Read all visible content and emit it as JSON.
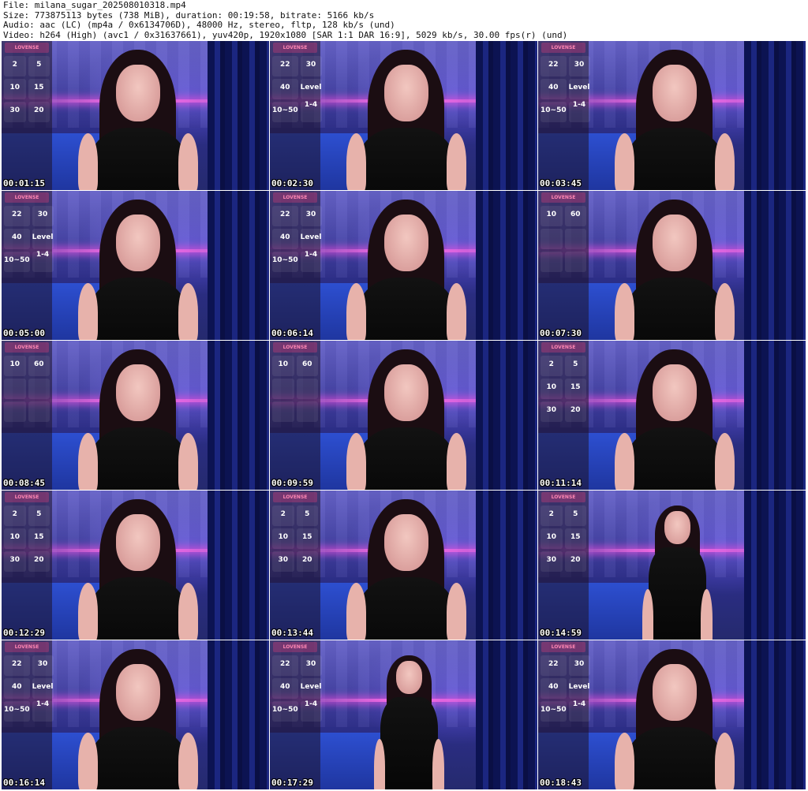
{
  "header": {
    "file": "File: milana_sugar_202508010318.mp4",
    "size": "Size: 773875113 bytes (738 MiB), duration: 00:19:58, bitrate: 5166 kb/s",
    "audio": "Audio: aac (LC) (mp4a / 0x6134706D), 48000 Hz, stereo, fltp, 128 kb/s (und)",
    "video": "Video: h264 (High) (avc1 / 0x31637661), yuv420p, 1920x1080 [SAR 1:1 DAR 16:9], 5029 kb/s, 30.00 fps(r) (und)"
  },
  "thumbnails": [
    {
      "time": "00:01:15"
    },
    {
      "time": "00:02:30"
    },
    {
      "time": "00:03:45"
    },
    {
      "time": "00:05:00"
    },
    {
      "time": "00:06:14"
    },
    {
      "time": "00:07:30"
    },
    {
      "time": "00:08:45"
    },
    {
      "time": "00:09:59"
    },
    {
      "time": "00:11:14"
    },
    {
      "time": "00:12:29"
    },
    {
      "time": "00:13:44"
    },
    {
      "time": "00:14:59"
    },
    {
      "time": "00:16:14"
    },
    {
      "time": "00:17:29"
    },
    {
      "time": "00:18:43"
    }
  ],
  "overlay_brand": "LOVENSE",
  "tile_sets": {
    "a": [
      "2",
      "5",
      "10",
      "15",
      "30",
      "20"
    ],
    "b": [
      "22",
      "30",
      "40",
      "Level 1-4",
      "10~50",
      ""
    ],
    "c": [
      "10",
      "60",
      "",
      "",
      "",
      ""
    ]
  },
  "colors": {
    "background": "#ffffff",
    "header_text": "#111111",
    "timestamp_text": "#ffffff",
    "neon_accent": "#ff6be6",
    "room_blue": "#2e2f8f"
  }
}
